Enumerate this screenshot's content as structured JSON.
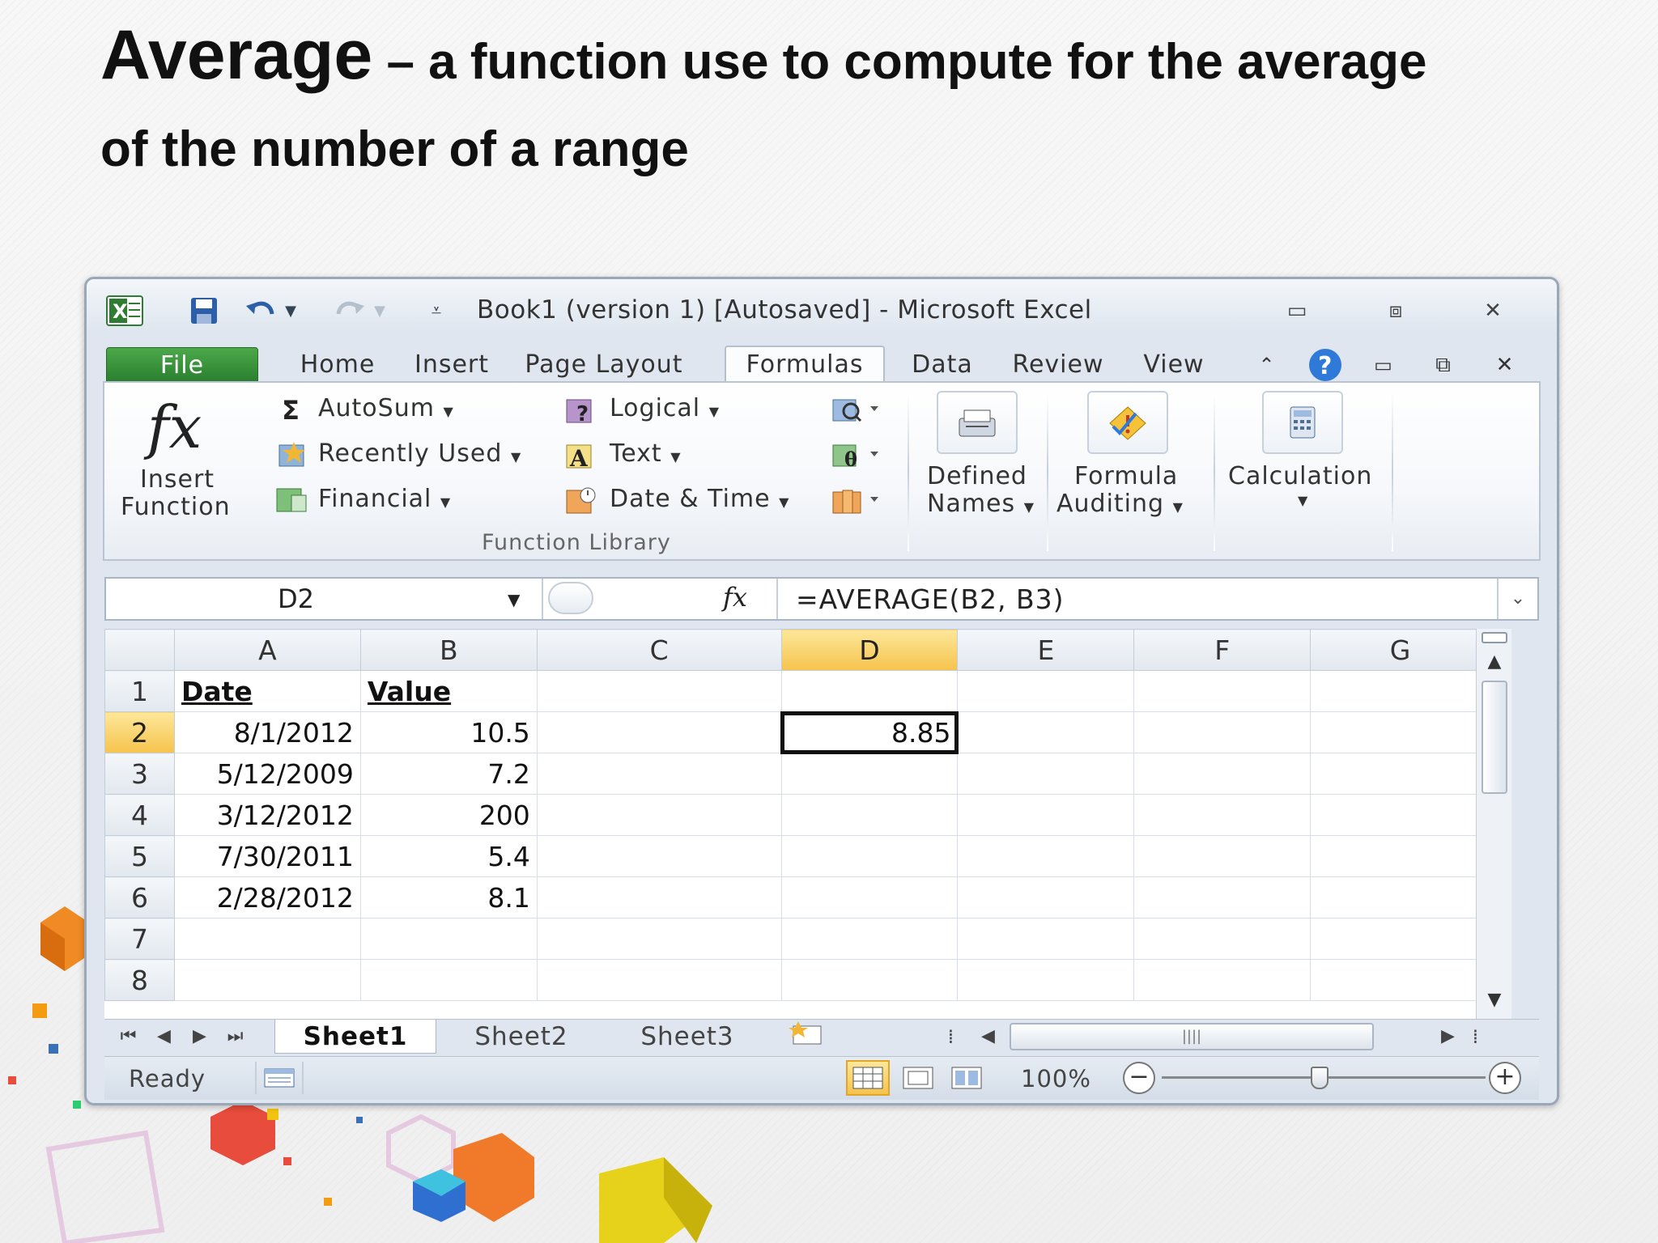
{
  "slide": {
    "title_main": "Average",
    "title_rest": " – a function use to compute for the average",
    "title_line2": "of the  number of a range"
  },
  "window": {
    "title": "Book1 (version 1) [Autosaved]  -  Microsoft Excel"
  },
  "tabs": [
    "File",
    "Home",
    "Insert",
    "Page Layout",
    "Formulas",
    "Data",
    "Review",
    "View"
  ],
  "active_tab": "Formulas",
  "ribbon": {
    "insert_function_line1": "Insert",
    "insert_function_line2": "Function",
    "autosum": "AutoSum",
    "recently_used": "Recently Used",
    "financial": "Financial",
    "logical": "Logical",
    "text": "Text",
    "date_time": "Date & Time",
    "function_library": "Function Library",
    "defined_names_line1": "Defined",
    "defined_names_line2": "Names",
    "formula_auditing_line1": "Formula",
    "formula_auditing_line2": "Auditing",
    "calculation": "Calculation"
  },
  "formula_bar": {
    "name_box": "D2",
    "fx": "fx",
    "formula": "=AVERAGE(B2, B3)"
  },
  "sheet": {
    "columns": [
      "A",
      "B",
      "C",
      "D",
      "E",
      "F",
      "G"
    ],
    "rows": [
      {
        "n": "1",
        "A": "Date",
        "B": "Value",
        "D": ""
      },
      {
        "n": "2",
        "A": "8/1/2012",
        "B": "10.5",
        "D": "8.85"
      },
      {
        "n": "3",
        "A": "5/12/2009",
        "B": "7.2",
        "D": ""
      },
      {
        "n": "4",
        "A": "3/12/2012",
        "B": "200",
        "D": ""
      },
      {
        "n": "5",
        "A": "7/30/2011",
        "B": "5.4",
        "D": ""
      },
      {
        "n": "6",
        "A": "2/28/2012",
        "B": "8.1",
        "D": ""
      },
      {
        "n": "7",
        "A": "",
        "B": "",
        "D": ""
      },
      {
        "n": "8",
        "A": "",
        "B": "",
        "D": ""
      }
    ],
    "selected_column": "D",
    "selected_row": "2"
  },
  "sheet_tabs": [
    "Sheet1",
    "Sheet2",
    "Sheet3"
  ],
  "status": {
    "ready": "Ready",
    "zoom": "100%"
  },
  "colors": {
    "file_tab": "#2a7f2e",
    "selected_header": "#f6c34d",
    "window_frame": "#9aa7b6"
  }
}
